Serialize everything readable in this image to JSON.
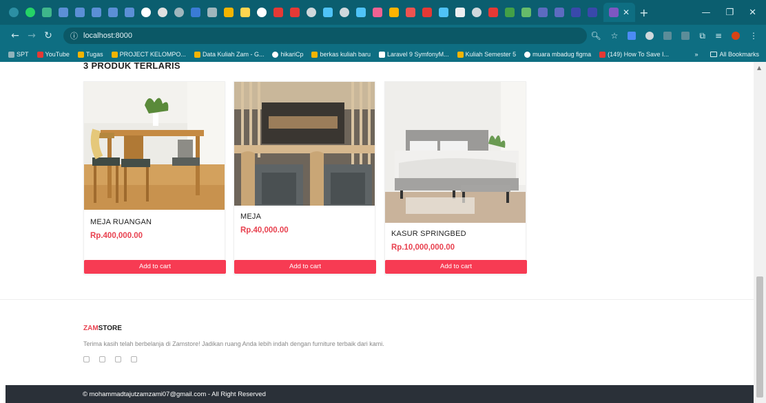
{
  "browser": {
    "url": "localhost:8000",
    "bookmarks": [
      "SPT",
      "YouTube",
      "Tugas",
      "PROJECT KELOMPO...",
      "Data Kuliah Zam - G...",
      "hikariCp",
      "berkas kuliah baru",
      "Laravel 9 SymfonyM...",
      "Kuliah Semester 5",
      "muara mbadug figma",
      "(149) How To Save I..."
    ],
    "bookmarks_more": "»",
    "all_bookmarks": "All Bookmarks"
  },
  "section_title": "3 PRODUK TERLARIS",
  "products": [
    {
      "name": "MEJA RUANGAN",
      "price": "Rp.400,000.00",
      "button": "Add to cart"
    },
    {
      "name": "MEJA",
      "price": "Rp.40,000.00",
      "button": "Add to cart"
    },
    {
      "name": "KASUR SPRINGBED",
      "price": "Rp.10,000,000.00",
      "button": "Add to cart"
    }
  ],
  "footer": {
    "brand_accent": "ZAM",
    "brand_rest": "STORE",
    "tagline": "Terima kasih telah berbelanja di Zamstore! Jadikan ruang Anda lebih indah dengan furniture terbaik dari kami.",
    "copyright": "© mohammadtajutzamzami07@gmail.com - All Right Reserved"
  },
  "colors": {
    "accent": "#e8414f",
    "button": "#f73b53",
    "browser_chrome": "#0e6e82",
    "footer_bar": "#2a3038"
  }
}
